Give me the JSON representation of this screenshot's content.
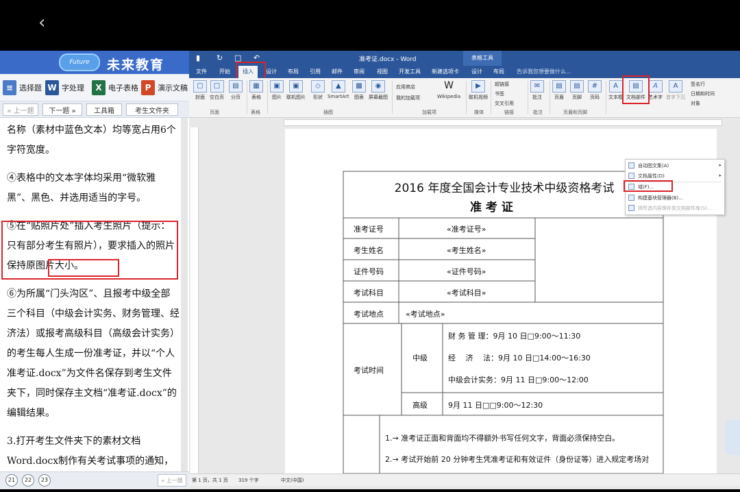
{
  "left_panel": {
    "brand": "未来教育",
    "logo_text": "Future",
    "tabs": [
      {
        "icon": "≡",
        "label": "选择题",
        "color": "#4a7bc8"
      },
      {
        "icon": "W",
        "label": "字处理",
        "color": "#2b579a"
      },
      {
        "icon": "X",
        "label": "电子表格",
        "color": "#217346"
      },
      {
        "icon": "P",
        "label": "演示文稿",
        "color": "#d24726"
      }
    ],
    "nav": {
      "prev": "« 上一题",
      "next": "下一题 »",
      "toolbox": "工具箱",
      "folder": "考生文件夹"
    },
    "paragraphs": [
      "名称（素材中蓝色文本）均等宽占用6个字符宽度。",
      "④表格中的文本字体均采用“微软雅黑”、黑色、并选用适当的字号。",
      "⑤在“贴照片处”插入考生照片（提示：只有部分考生有照片），要求插入的照片保持原图片大小。",
      "⑥为所属“门头沟区”、且报考中级全部三个科目（中级会计实务、财务管理、经济法）或报考高级科目（高级会计实务）的考生每人生成一份准考证，并以“个人准考证.docx”为文件名保存到考生文件夹下，同时保存主文档“准考证.docx”的编辑结果。",
      "3.打开考生文件夹下的素材文档Word.docx制作有关考试事项的通知，"
    ],
    "page_buttons": [
      "21",
      "22",
      "23"
    ],
    "footer_prev": "« 上一题"
  },
  "word": {
    "title": "准考证.docx - Word",
    "table_tools": "表格工具",
    "tabs": [
      "文件",
      "开始",
      "插入",
      "设计",
      "布局",
      "引用",
      "邮件",
      "审阅",
      "视图",
      "开发工具",
      "新建选项卡",
      "设计",
      "布局"
    ],
    "active_tab": "插入",
    "tell_me": "告诉我您想要做什么...",
    "ribbon_buttons": [
      "封面",
      "空白页",
      "分页",
      "表格",
      "图片",
      "联机图片",
      "形状",
      "SmartArt",
      "图表",
      "屏幕截图",
      "应用商店",
      "我的加载项",
      "Wikipedia",
      "联机视频",
      "超链接",
      "书签",
      "交叉引用",
      "批注",
      "页眉",
      "页脚",
      "页码",
      "文本框",
      "文档部件",
      "艺术字",
      "首字下沉",
      "签名行",
      "日期和时间",
      "对象"
    ],
    "groups": [
      "页面",
      "表格",
      "插图",
      "加载项",
      "媒体",
      "链接",
      "批注",
      "页眉和页脚"
    ],
    "dropdown": [
      "自动图文集(A)",
      "文档属性(D)",
      "域(F)...",
      "构建基块管理器(B)...",
      "将所选内容保存到文档部件库(S)..."
    ],
    "status": {
      "page": "第 1 页，共 1 页",
      "words": "319 个字",
      "lang": "中文(中国)"
    }
  },
  "ticket": {
    "title": "2016 年度全国会计专业技术中级资格考试",
    "subtitle": "准 考 证",
    "rows": [
      {
        "label": "准考证号",
        "value": "«准考证号»"
      },
      {
        "label": "考生姓名",
        "value": "«考生姓名»"
      },
      {
        "label": "证件号码",
        "value": "«证件号码»"
      },
      {
        "label": "考试科目",
        "value": "«考试科目»"
      }
    ],
    "location_label": "考试地点",
    "location_value": "«考试地点»",
    "time_label": "考试时间",
    "mid_label": "中级",
    "mid_items": [
      "财 务 管 理：9月 10 日□9:00～11:30",
      "经　 济　 法：9月 10 日□14:00～16:30",
      "中级会计实务：9月 11 日□9:00～12:00"
    ],
    "high_label": "高级",
    "high_item": "9月 11 日□□9:00～12:30",
    "notes": [
      "1.→ 准考证正面和背面均不得额外书写任何文字，背面必须保持空白。",
      "2.→ 考试开始前 20 分钟考生凭准考证和有效证件（身份证等）进入规定考场对"
    ]
  }
}
